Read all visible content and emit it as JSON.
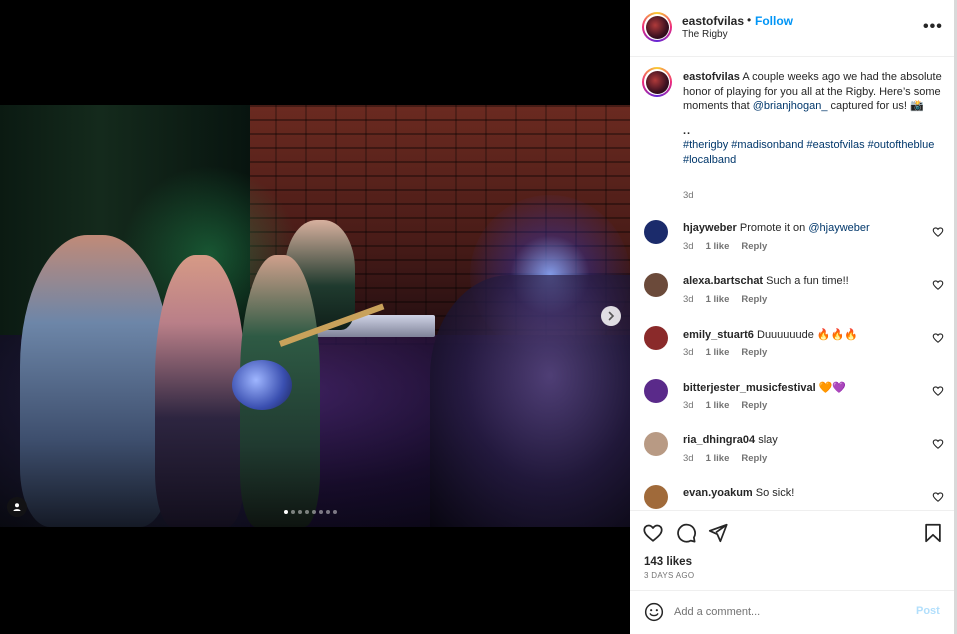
{
  "post": {
    "image_alt": "Band performing at The Rigby",
    "carousel": {
      "total": 8,
      "active_index": 0
    }
  },
  "header": {
    "username": "eastofvilas",
    "separator": "•",
    "follow_label": "Follow",
    "location": "The Rigby",
    "more_icon": "more-options-icon",
    "more_label": "•••"
  },
  "caption": {
    "username": "eastofvilas",
    "text_before_mention": " A couple weeks ago we had the absolute honor of playing for you all at the Rigby. Here’s some moments that ",
    "mention": "@brianjhogan_",
    "text_after_mention": " captured for us! 📸",
    "dots": "..",
    "hashtags": "#therigby #madisonband #eastofvilas #outoftheblue #localband",
    "time": "3d"
  },
  "comments": [
    {
      "username": "hjayweber",
      "text": " Promote it on ",
      "mention": "@hjayweber",
      "time": "3d",
      "likes": "1 like",
      "reply": "Reply",
      "avatar_color": "#1b2b6b"
    },
    {
      "username": "alexa.bartschat",
      "text": " Such a fun time!!",
      "mention": "",
      "time": "3d",
      "likes": "1 like",
      "reply": "Reply",
      "avatar_color": "#6b4a3a"
    },
    {
      "username": "emily_stuart6",
      "text": " Duuuuuude 🔥🔥🔥",
      "mention": "",
      "time": "3d",
      "likes": "1 like",
      "reply": "Reply",
      "avatar_color": "#8a2a2a"
    },
    {
      "username": "bitterjester_musicfestival",
      "text": " 🧡💜",
      "mention": "",
      "time": "3d",
      "likes": "1 like",
      "reply": "Reply",
      "avatar_color": "#5a2a8a"
    },
    {
      "username": "ria_dhingra04",
      "text": " slay",
      "mention": "",
      "time": "3d",
      "likes": "1 like",
      "reply": "Reply",
      "avatar_color": "#b89a84"
    },
    {
      "username": "evan.yoakum",
      "text": " So sick!",
      "mention": "",
      "time": "",
      "likes": "",
      "reply": "",
      "avatar_color": "#a06a3a"
    }
  ],
  "actions": {
    "like_icon": "heart-icon",
    "comment_icon": "comment-bubble-icon",
    "share_icon": "paper-plane-icon",
    "save_icon": "bookmark-icon"
  },
  "likes_count": "143 likes",
  "posted_ago": "3 DAYS AGO",
  "add_comment": {
    "placeholder": "Add a comment...",
    "post_label": "Post",
    "emoji_icon": "emoji-smiley-icon"
  },
  "colors": {
    "accent_blue": "#0095f6",
    "post_disabled": "#b2dffc",
    "mention_blue": "#00376b",
    "text_primary": "#262626",
    "text_secondary": "#737373"
  }
}
